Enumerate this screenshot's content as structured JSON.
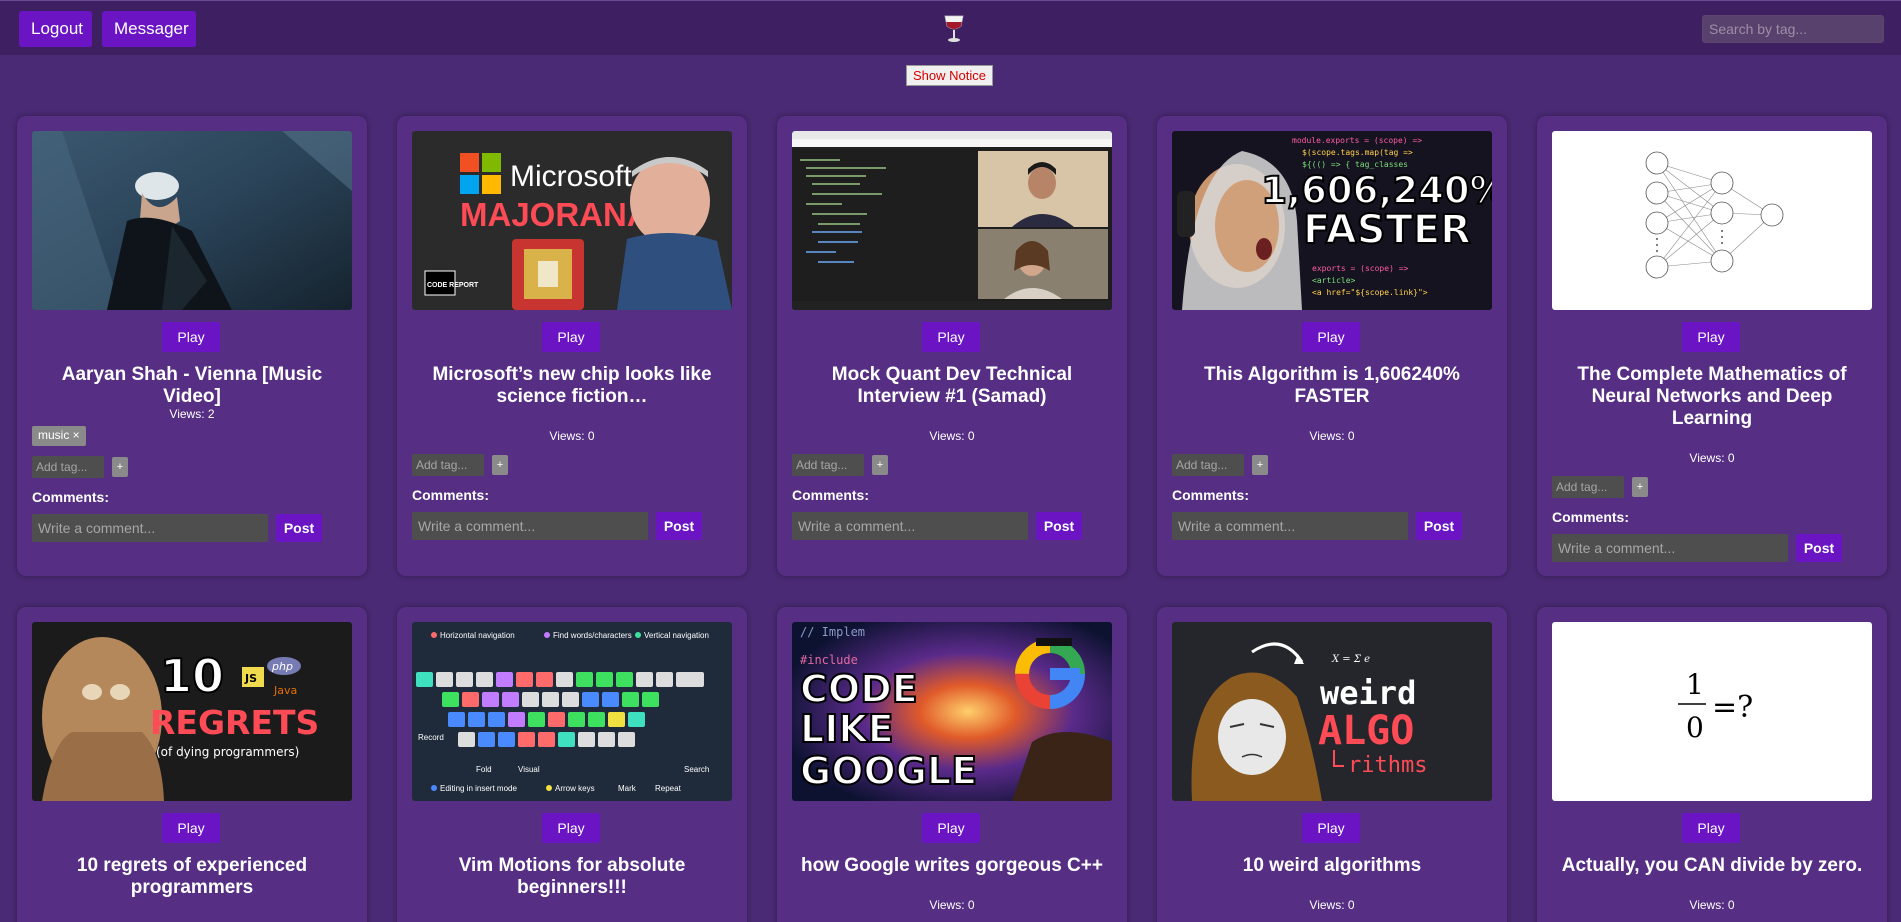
{
  "topbar": {
    "logout_label": "Logout",
    "messager_label": "Messager",
    "logo_icon": "wine-glass-icon",
    "search_placeholder": "Search by tag..."
  },
  "notice": {
    "label": "Show Notice"
  },
  "accent_color": "#6a14c4",
  "videos": [
    {
      "title": "Aaryan Shah - Vienna [Music Video]",
      "views": "Views: 2",
      "tags": [
        "music ×"
      ],
      "thumb": "music-video"
    },
    {
      "title": "Microsoft’s new chip looks like science fiction…",
      "views": "Views: 0",
      "tags": [],
      "thumb": "microsoft-majorana",
      "thumb_text": {
        "line1": "Microsoft",
        "line2": "MAJORANA",
        "badge": "CODE REPORT"
      }
    },
    {
      "title": "Mock Quant Dev Technical Interview #1 (Samad)",
      "views": "Views: 0",
      "tags": [],
      "thumb": "interview-screen"
    },
    {
      "title": "This Algorithm is 1,606240% FASTER",
      "views": "Views: 0",
      "tags": [],
      "thumb": "faster-algorithm",
      "thumb_text": {
        "line1": "1,606,240%",
        "line2": "FASTER"
      }
    },
    {
      "title": "The Complete Mathematics of Neural Networks and Deep Learning",
      "views": "Views: 0",
      "tags": [],
      "thumb": "neural-network-diagram"
    },
    {
      "title": "10 regrets of experienced programmers",
      "views": "Views: 0",
      "tags": [],
      "thumb": "regrets",
      "thumb_text": {
        "line1": "10",
        "line2": "REGRETS",
        "line3": "(of dying programmers)",
        "js": "JS",
        "php": "php",
        "java": "Java"
      }
    },
    {
      "title": "Vim Motions for absolute beginners!!!",
      "views": "Views: 0",
      "tags": [],
      "thumb": "vim-keyboard",
      "thumb_text": {
        "l1": "Horizontal navigation",
        "l2": "Find words/characters",
        "l3": "Vertical navigation",
        "l4": "Record",
        "l5": "Fold",
        "l6": "Visual",
        "l7": "Search",
        "l8": "Editing in insert mode",
        "l9": "Arrow keys",
        "l10": "Mark",
        "l11": "Repeat"
      }
    },
    {
      "title": "how Google writes gorgeous C++",
      "views": "Views: 0",
      "tags": [],
      "thumb": "code-like-google",
      "thumb_text": {
        "line1": "CODE",
        "line2": "LIKE",
        "line3": "GOOGLE",
        "code": "// Implem",
        "inc": "#include"
      }
    },
    {
      "title": "10 weird algorithms",
      "views": "Views: 0",
      "tags": [],
      "thumb": "weird-algorithms",
      "thumb_text": {
        "line1": "weird",
        "line2": "ALGO",
        "line3": "rithms"
      }
    },
    {
      "title": "Actually, you CAN divide by zero.",
      "views": "Views: 0",
      "tags": [],
      "thumb": "divide-by-zero",
      "thumb_text": {
        "num": "1",
        "den": "0",
        "rest": "=?"
      }
    }
  ],
  "card": {
    "play_label": "Play",
    "add_tag_placeholder": "Add tag...",
    "add_tag_label": "+",
    "comments_label": "Comments:",
    "comment_placeholder": "Write a comment...",
    "post_label": "Post"
  }
}
